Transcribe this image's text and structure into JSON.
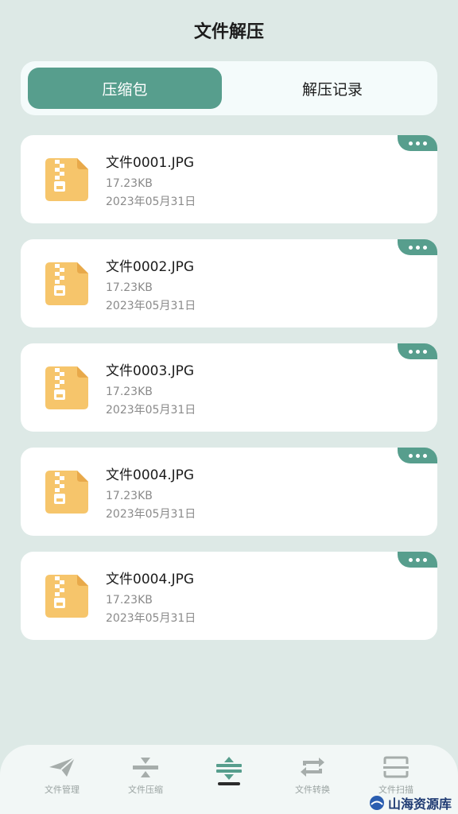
{
  "header": {
    "title": "文件解压"
  },
  "tabs": [
    {
      "label": "压缩包",
      "active": true
    },
    {
      "label": "解压记录",
      "active": false
    }
  ],
  "files": [
    {
      "name": "文件0001.JPG",
      "size": "17.23KB",
      "date": "2023年05月31日"
    },
    {
      "name": "文件0002.JPG",
      "size": "17.23KB",
      "date": "2023年05月31日"
    },
    {
      "name": "文件0003.JPG",
      "size": "17.23KB",
      "date": "2023年05月31日"
    },
    {
      "name": "文件0004.JPG",
      "size": "17.23KB",
      "date": "2023年05月31日"
    },
    {
      "name": "文件0004.JPG",
      "size": "17.23KB",
      "date": "2023年05月31日"
    }
  ],
  "bottom_nav": [
    {
      "label": "文件管理",
      "icon": "send-icon"
    },
    {
      "label": "文件压缩",
      "icon": "compress-icon"
    },
    {
      "label": "",
      "icon": "extract-icon",
      "active": true
    },
    {
      "label": "文件转换",
      "icon": "convert-icon"
    },
    {
      "label": "文件扫描",
      "icon": "scan-icon"
    }
  ],
  "watermark": "山海资源库",
  "colors": {
    "accent": "#579e8d",
    "background": "#dde9e6",
    "zip_icon": "#f6c56b"
  }
}
